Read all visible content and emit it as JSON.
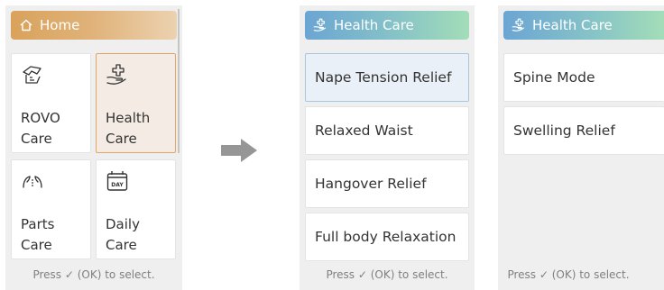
{
  "home_panel": {
    "header": {
      "title": "Home",
      "icon": "home-icon"
    },
    "tiles": [
      {
        "label": "ROVO\nCare",
        "icon": "rovo-care-icon"
      },
      {
        "label": "Health\nCare",
        "icon": "health-care-icon",
        "selected": true
      },
      {
        "label": "Parts\nCare",
        "icon": "parts-care-icon"
      },
      {
        "label": "Daily\nCare",
        "icon": "daily-care-icon"
      }
    ],
    "hint": "Press ✓ (OK) to select."
  },
  "transition": {
    "icon": "right-arrow-icon"
  },
  "health_panel_1": {
    "header": {
      "title": "Health Care",
      "icon": "health-care-icon"
    },
    "items": [
      {
        "label": "Nape Tension Relief",
        "selected": true
      },
      {
        "label": "Relaxed Waist"
      },
      {
        "label": "Hangover Relief"
      },
      {
        "label": "Full body Relaxation"
      }
    ],
    "hint": "Press ✓ (OK) to select."
  },
  "health_panel_2": {
    "header": {
      "title": "Health Care",
      "icon": "health-care-icon"
    },
    "items": [
      {
        "label": "Spine Mode"
      },
      {
        "label": "Swelling Relief"
      }
    ],
    "hint": "Press ✓ (OK) to select."
  },
  "colors": {
    "home_header": "#d9a25c",
    "health_header": "#6ba5d3",
    "tile_selected_border": "#e2a663",
    "item_selected_bg": "#e9f0f7"
  }
}
